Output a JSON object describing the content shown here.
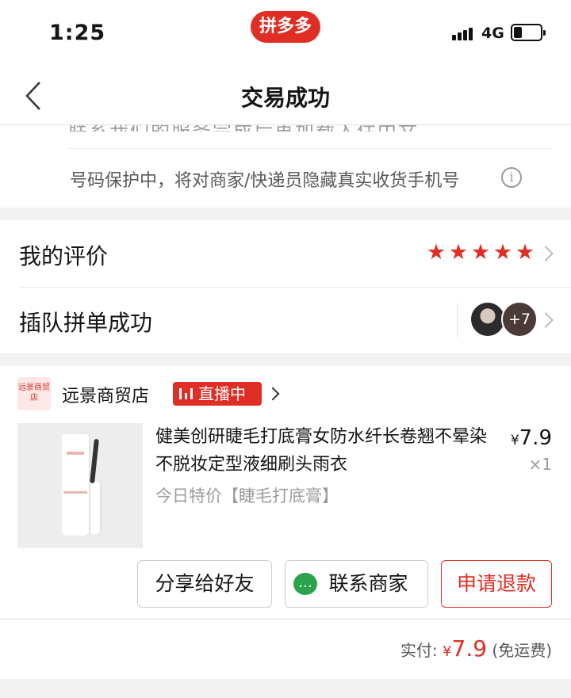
{
  "status_bar": {
    "time": "1:25",
    "app_badge": "拼多多",
    "network": "4G"
  },
  "nav": {
    "title": "交易成功"
  },
  "privacy": {
    "partial_text": "联系我们的服务完成后再加载入住中文",
    "note": "号码保护中，将对商家/快递员隐藏真实收货手机号",
    "info_icon": "i"
  },
  "review": {
    "label": "我的评价",
    "stars": 5,
    "star_glyph": "★"
  },
  "group": {
    "label": "插队拼单成功",
    "extra_count": "+7"
  },
  "shop": {
    "logo_text": "远景商贸店",
    "name": "远景商贸店",
    "live_label": "直播中"
  },
  "product": {
    "title": "健美创研睫毛打底膏女防水纤长卷翘不晕染不脱妆定型液细刷头雨衣",
    "currency": "¥",
    "price": "7.9",
    "quantity": "×1",
    "tag": "今日特价【睫毛打底膏】"
  },
  "actions": {
    "share": "分享给好友",
    "contact": "联系商家",
    "refund": "申请退款"
  },
  "payment": {
    "label": "实付:",
    "currency": "¥",
    "amount": "7.9",
    "shipping": "(免运费)"
  },
  "colors": {
    "brand": "#e02e24",
    "wechat_green": "#2ba24c"
  }
}
